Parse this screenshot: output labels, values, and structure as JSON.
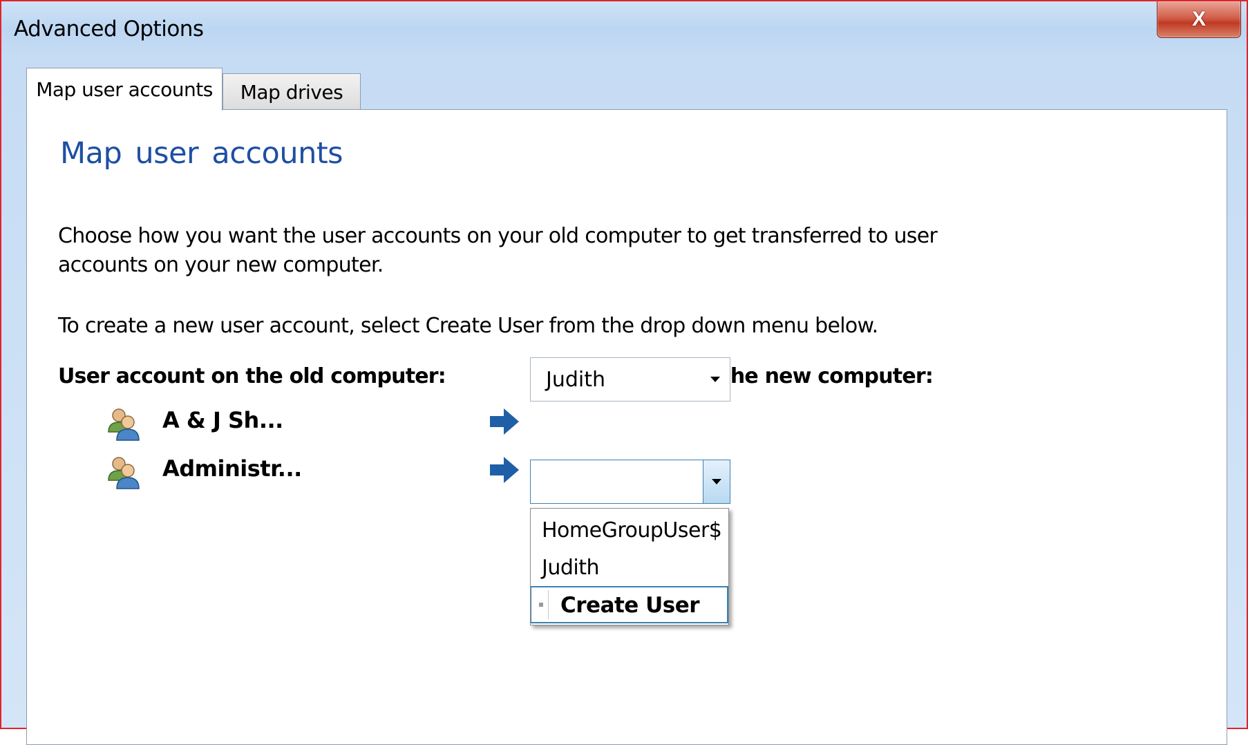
{
  "window": {
    "title": "Advanced Options",
    "close_label": "X"
  },
  "tabs": [
    {
      "label": "Map user accounts",
      "active": true
    },
    {
      "label": "Map drives",
      "active": false
    }
  ],
  "main": {
    "heading": "Map user accounts",
    "description": "Choose how you want the user accounts on your old computer to get transferred to user accounts on your new computer.",
    "instruction": "To create a new user account, select Create User from the drop down menu below.",
    "old_column_header": "User account on the old computer:",
    "new_column_header": "User account on the new computer:"
  },
  "accounts": [
    {
      "old_name": "A & J Sh...",
      "new_value": "Judith"
    },
    {
      "old_name": "Administr...",
      "new_value": ""
    }
  ],
  "dropdown": {
    "options": [
      "HomeGroupUser$",
      "Judith",
      "Create User"
    ],
    "highlighted": "Create User"
  },
  "colors": {
    "heading": "#1e4fa3",
    "arrow": "#1f5fa8",
    "focus_border": "#3c7fb1",
    "window_border": "#e0242c"
  },
  "icons": {
    "user_account": "users-icon",
    "mapping_arrow": "arrow-right-icon",
    "combo_toggle": "chevron-down-icon"
  }
}
